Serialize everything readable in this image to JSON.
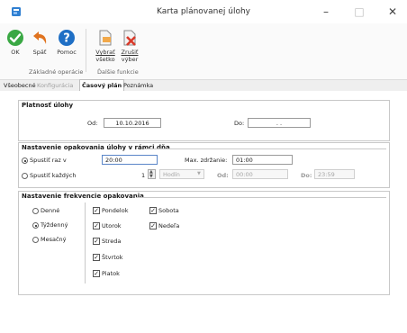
{
  "window": {
    "title": "Karta plánovanej úlohy",
    "controls": {
      "minimize": "–",
      "maximize": "□",
      "close": "✕"
    }
  },
  "ribbon": {
    "groups": [
      {
        "label": "Základné operácie"
      },
      {
        "label": "Ďalšie funkcie"
      }
    ],
    "buttons": {
      "ok": "OK",
      "back": "Späť",
      "help": "Pomoc",
      "select_all_line1": "Vybrať",
      "select_all_line2": "všetko",
      "cancel_sel_line1": "Zrušiť",
      "cancel_sel_line2": "výber"
    }
  },
  "tabs": [
    {
      "label": "Všeobecné",
      "state": "normal"
    },
    {
      "label": "Konfigurácia",
      "state": "disabled"
    },
    {
      "label": "Časový plán",
      "state": "active"
    },
    {
      "label": "Poznámka",
      "state": "normal"
    }
  ],
  "validity": {
    "title": "Platnosť úlohy",
    "from_label": "Od:",
    "from_value": "10.10.2016",
    "to_label": "Do:",
    "to_value": ". ."
  },
  "daily": {
    "title": "Nastavenie opakovania úlohy v rámci dňa",
    "run_once_label": "Spustiť raz v",
    "run_once_value": "20:00",
    "max_delay_label": "Max. zdržanie:",
    "max_delay_value": "01:00",
    "run_every_label": "Spustiť každých",
    "every_value": "1",
    "unit_value": "Hodín",
    "from_label": "Od:",
    "from_value": "00:00",
    "to_label": "Do:",
    "to_value": "23:59"
  },
  "frequency": {
    "title": "Nastavenie frekvencie opakovania",
    "options": [
      "Denné",
      "Týždenný",
      "Mesačný"
    ],
    "selected": "Týždenný",
    "days": {
      "mon": "Pondelok",
      "tue": "Utorok",
      "wed": "Streda",
      "thu": "Štvrtok",
      "fri": "Piatok",
      "sat": "Sobota",
      "sun": "Nedeľa"
    },
    "all_days_checked": true
  },
  "colors": {
    "ok_green": "#3aa844",
    "back_orange": "#e0731f",
    "help_blue": "#1f6fc5",
    "cancel_red": "#d93a2a"
  }
}
